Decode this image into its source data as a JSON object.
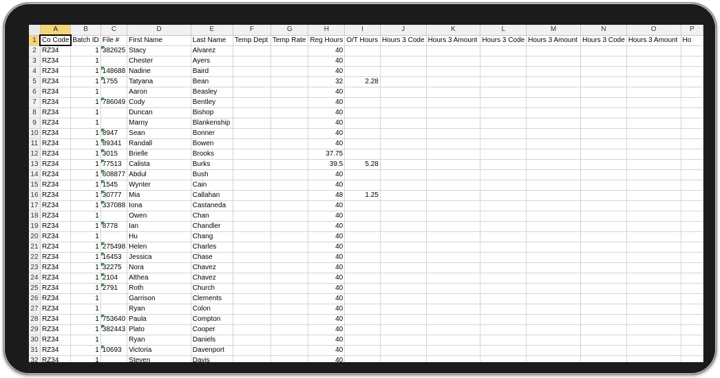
{
  "spreadsheet": {
    "columns": [
      "A",
      "B",
      "C",
      "D",
      "E",
      "F",
      "G",
      "H",
      "I",
      "J",
      "K",
      "L",
      "M",
      "N",
      "O",
      "P"
    ],
    "header_cells": [
      "Co Code",
      "Batch ID",
      "File #",
      "First Name",
      "Last Name",
      "Temp Dept",
      "Temp Rate",
      "Reg Hours",
      "O/T Hours",
      "Hours 3 Code",
      "Hours 3 Amount",
      "Hours 3 Code",
      "Hours 3 Amount",
      "Hours 3 Code",
      "Hours 3 Amount",
      "Ho"
    ],
    "active_cell": "A1",
    "rows": [
      [
        "RZ34",
        "1",
        "382625",
        "Stacy",
        "Alvarez",
        "",
        "",
        "40",
        ""
      ],
      [
        "RZ34",
        "1",
        "",
        "Chester",
        "Ayers",
        "",
        "",
        "40",
        ""
      ],
      [
        "RZ34",
        "1",
        "148688",
        "Nadine",
        "Baird",
        "",
        "",
        "40",
        ""
      ],
      [
        "RZ34",
        "1",
        "1755",
        "Tatyana",
        "Bean",
        "",
        "",
        "32",
        "2.28"
      ],
      [
        "RZ34",
        "1",
        "",
        "Aaron",
        "Beasley",
        "",
        "",
        "40",
        ""
      ],
      [
        "RZ34",
        "1",
        "786049",
        "Cody",
        "Bentley",
        "",
        "",
        "40",
        ""
      ],
      [
        "RZ34",
        "1",
        "",
        "Duncan",
        "Bishop",
        "",
        "",
        "40",
        ""
      ],
      [
        "RZ34",
        "1",
        "",
        "Marny",
        "Blankenship",
        "",
        "",
        "40",
        ""
      ],
      [
        "RZ34",
        "1",
        "8947",
        "Sean",
        "Bonner",
        "",
        "",
        "40",
        ""
      ],
      [
        "RZ34",
        "1",
        "89341",
        "Randall",
        "Bowen",
        "",
        "",
        "40",
        ""
      ],
      [
        "RZ34",
        "1",
        "3015",
        "Brielle",
        "Brooks",
        "",
        "",
        "37.75",
        ""
      ],
      [
        "RZ34",
        "1",
        "77513",
        "Calista",
        "Burks",
        "",
        "",
        "39.5",
        "5.28"
      ],
      [
        "RZ34",
        "1",
        "608877",
        "Abdul",
        "Bush",
        "",
        "",
        "40",
        ""
      ],
      [
        "RZ34",
        "1",
        "1545",
        "Wynter",
        "Cain",
        "",
        "",
        "40",
        ""
      ],
      [
        "RZ34",
        "1",
        "30777",
        "Mia",
        "Callahan",
        "",
        "",
        "48",
        "1.25"
      ],
      [
        "RZ34",
        "1",
        "337088",
        "Iona",
        "Castaneda",
        "",
        "",
        "40",
        ""
      ],
      [
        "RZ34",
        "1",
        "",
        "Owen",
        "Chan",
        "",
        "",
        "40",
        ""
      ],
      [
        "RZ34",
        "1",
        "8778",
        "Ian",
        "Chandler",
        "",
        "",
        "40",
        ""
      ],
      [
        "RZ34",
        "1",
        "",
        "Hu",
        "Chang",
        "",
        "",
        "40",
        ""
      ],
      [
        "RZ34",
        "1",
        "275498",
        "Helen",
        "Charles",
        "",
        "",
        "40",
        ""
      ],
      [
        "RZ34",
        "1",
        "16453",
        "Jessica",
        "Chase",
        "",
        "",
        "40",
        ""
      ],
      [
        "RZ34",
        "1",
        "32275",
        "Nora",
        "Chavez",
        "",
        "",
        "40",
        ""
      ],
      [
        "RZ34",
        "1",
        "2104",
        "Althea",
        "Chavez",
        "",
        "",
        "40",
        ""
      ],
      [
        "RZ34",
        "1",
        "2791",
        "Roth",
        "Church",
        "",
        "",
        "40",
        ""
      ],
      [
        "RZ34",
        "1",
        "",
        "Garrison",
        "Clements",
        "",
        "",
        "40",
        ""
      ],
      [
        "RZ34",
        "1",
        "",
        "Ryan",
        "Colon",
        "",
        "",
        "40",
        ""
      ],
      [
        "RZ34",
        "1",
        "753640",
        "Paula",
        "Compton",
        "",
        "",
        "40",
        ""
      ],
      [
        "RZ34",
        "1",
        "382443",
        "Plato",
        "Cooper",
        "",
        "",
        "40",
        ""
      ],
      [
        "RZ34",
        "1",
        "",
        "Ryan",
        "Daniels",
        "",
        "",
        "40",
        ""
      ],
      [
        "RZ34",
        "1",
        "10693",
        "Victoria",
        "Davenport",
        "",
        "",
        "40",
        ""
      ],
      [
        "RZ34",
        "1",
        "",
        "Steven",
        "Davis",
        "",
        "",
        "40",
        ""
      ]
    ]
  }
}
